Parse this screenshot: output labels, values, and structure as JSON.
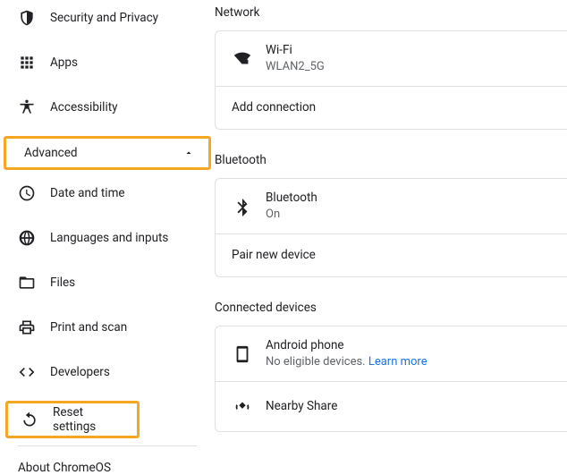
{
  "sidebar": {
    "items": [
      {
        "label": "Security and Privacy"
      },
      {
        "label": "Apps"
      },
      {
        "label": "Accessibility"
      }
    ],
    "advanced_label": "Advanced",
    "advanced_items": [
      {
        "label": "Date and time"
      },
      {
        "label": "Languages and inputs"
      },
      {
        "label": "Files"
      },
      {
        "label": "Print and scan"
      },
      {
        "label": "Developers"
      },
      {
        "label": "Reset settings"
      }
    ],
    "about_label": "About ChromeOS"
  },
  "main": {
    "network": {
      "title": "Network",
      "wifi": {
        "title": "Wi-Fi",
        "sub": "WLAN2_5G"
      },
      "add": "Add connection"
    },
    "bluetooth": {
      "title": "Bluetooth",
      "bt": {
        "title": "Bluetooth",
        "sub": "On"
      },
      "pair": "Pair new device"
    },
    "connected": {
      "title": "Connected devices",
      "android": {
        "title": "Android phone",
        "sub": "No eligible devices. ",
        "link": "Learn more"
      },
      "nearby": {
        "title": "Nearby Share"
      }
    }
  }
}
